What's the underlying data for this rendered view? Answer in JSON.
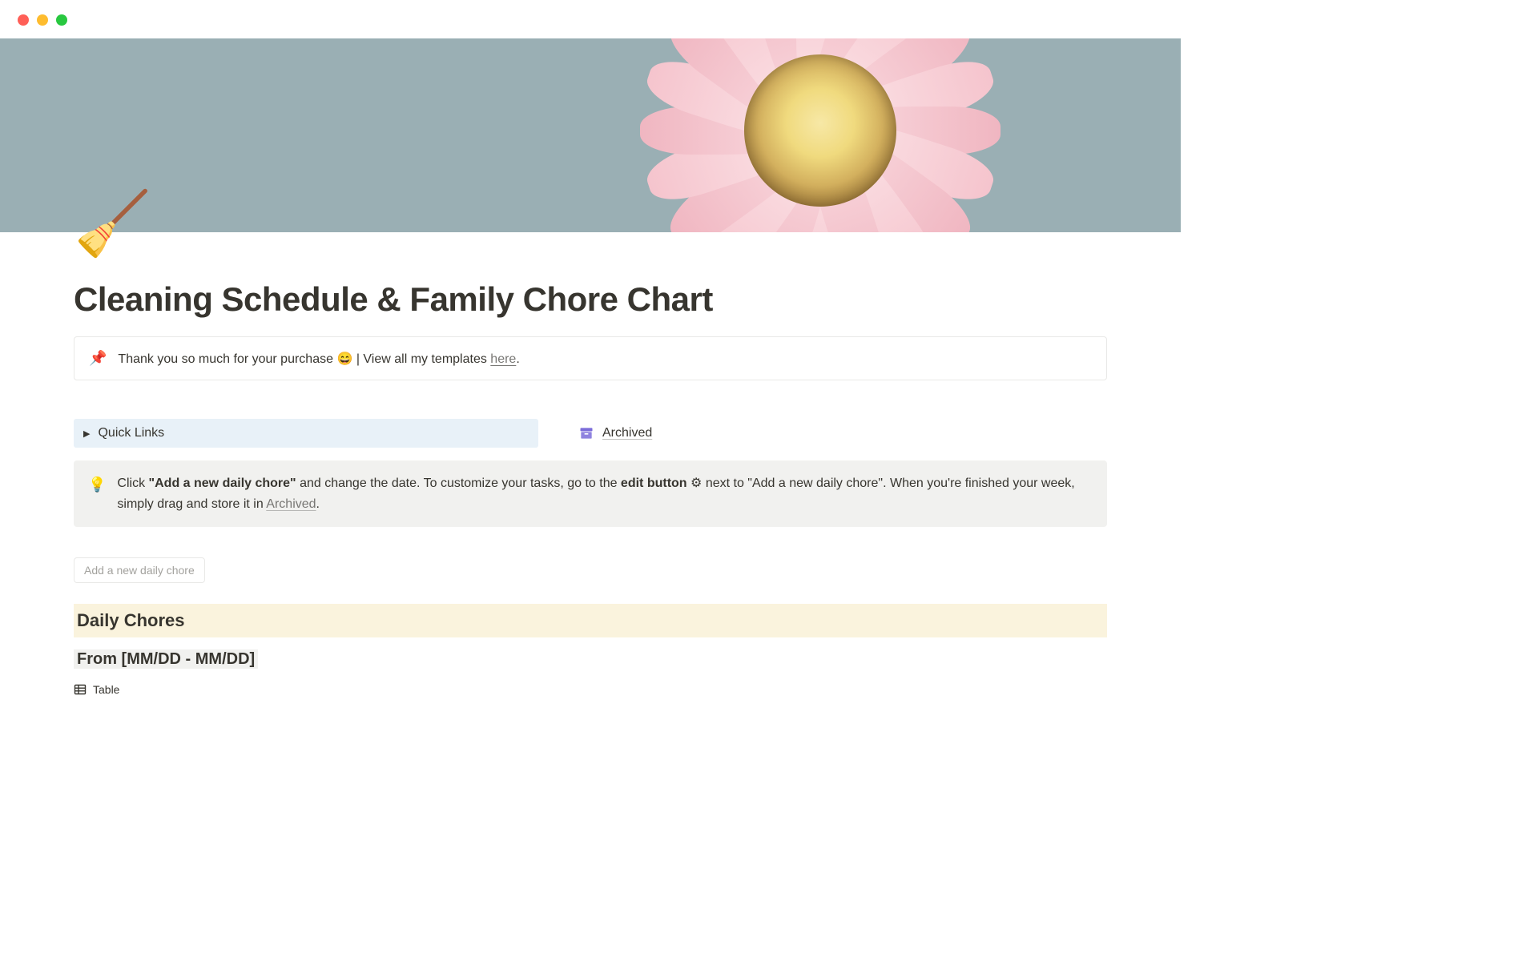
{
  "page": {
    "icon": "🧹",
    "title": "Cleaning Schedule & Family Chore Chart"
  },
  "thankyou_callout": {
    "icon": "📌",
    "text_before": "Thank you so much for your purchase ",
    "emoji_inline": "😄",
    "text_mid": " | View all my templates ",
    "link_text": "here",
    "text_after": "."
  },
  "quick_links": {
    "label": "Quick Links"
  },
  "archived": {
    "label": "Archived"
  },
  "tip_callout": {
    "icon": "💡",
    "text_1": "Click ",
    "strong_1": "\"Add a new daily chore\"",
    "text_2": " and change the date. To customize your tasks, go to the",
    "strong_2": " edit button",
    "gear_icon": " ⚙ ",
    "text_3": "next to \"Add a new daily chore\". When you're finished your week, simply drag and store it in ",
    "link_text": "Archived",
    "text_4": "."
  },
  "add_button": {
    "label": "Add a new daily chore"
  },
  "daily_section": {
    "header": "Daily Chores",
    "date_range": "From [MM/DD - MM/DD]"
  },
  "view_tab": {
    "label": "Table"
  }
}
